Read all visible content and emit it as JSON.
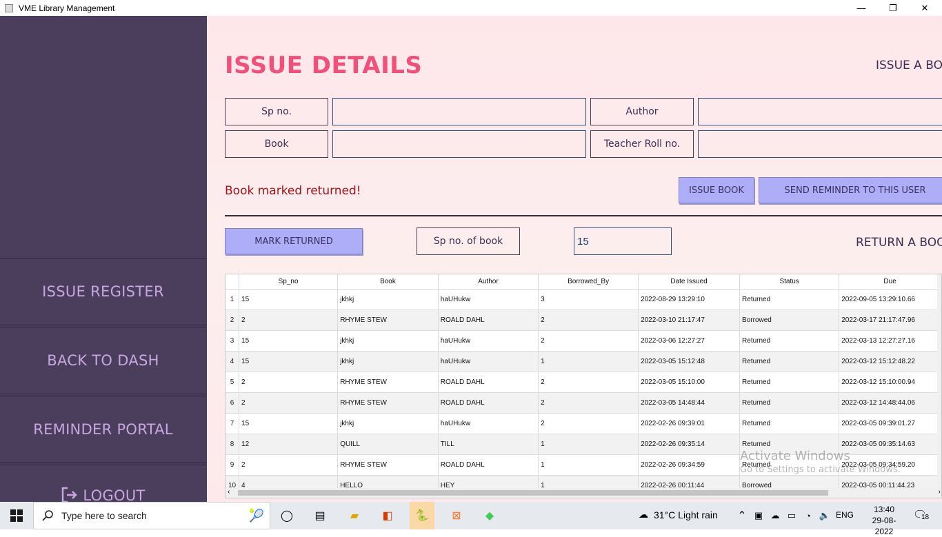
{
  "window": {
    "title": "VME Library Management",
    "minimize": "—",
    "restore": "❐",
    "close": "✕"
  },
  "sidebar": {
    "items": [
      {
        "label": "ISSUE REGISTER"
      },
      {
        "label": "BACK TO DASH"
      },
      {
        "label": "REMINDER PORTAL"
      },
      {
        "label": "LOGOUT"
      }
    ]
  },
  "main": {
    "title": "ISSUE DETAILS",
    "issue_section_label": "ISSUE A BOOK",
    "return_section_label": "RETURN A BOOK",
    "form": {
      "sp_no_label": "Sp no.",
      "sp_no_value": "",
      "author_label": "Author",
      "author_value": "",
      "book_label": "Book",
      "book_value": "",
      "teacher_roll_label": "Teacher Roll no.",
      "teacher_roll_value": ""
    },
    "status_message": "Book marked returned!",
    "issue_book_button": "ISSUE BOOK",
    "send_reminder_button": "SEND REMINDER TO THIS USER",
    "mark_returned_button": "MARK RETURNED",
    "sp_no_of_book_label": "Sp no. of book",
    "sp_no_of_book_value": "15"
  },
  "table": {
    "columns": [
      "Sp_no",
      "Book",
      "Author",
      "Borrowed_By",
      "Date Issued",
      "Status",
      "Due"
    ],
    "rows": [
      [
        "1",
        "15",
        "jkhkj",
        "haUHukw",
        "3",
        "2022-08-29 13:29:10",
        "Returned",
        "2022-09-05 13:29:10.66"
      ],
      [
        "2",
        "2",
        "RHYME STEW",
        "ROALD DAHL",
        "2",
        "2022-03-10 21:17:47",
        "Borrowed",
        "2022-03-17 21:17:47.96"
      ],
      [
        "3",
        "15",
        "jkhkj",
        "haUHukw",
        "2",
        "2022-03-06 12:27:27",
        "Returned",
        "2022-03-13 12:27:27.16"
      ],
      [
        "4",
        "15",
        "jkhkj",
        "haUHukw",
        "1",
        "2022-03-05 15:12:48",
        "Returned",
        "2022-03-12 15:12:48.22"
      ],
      [
        "5",
        "2",
        "RHYME STEW",
        "ROALD DAHL",
        "2",
        "2022-03-05 15:10:00",
        "Returned",
        "2022-03-12 15:10:00.94"
      ],
      [
        "6",
        "2",
        "RHYME STEW",
        "ROALD DAHL",
        "2",
        "2022-03-05 14:48:44",
        "Returned",
        "2022-03-12 14:48:44.06"
      ],
      [
        "7",
        "15",
        "jkhkj",
        "haUHukw",
        "2",
        "2022-02-26 09:39:01",
        "Returned",
        "2022-03-05 09:39:01.27"
      ],
      [
        "8",
        "12",
        "QUILL",
        "TILL",
        "1",
        "2022-02-26 09:35:14",
        "Returned",
        "2022-03-05 09:35:14.63"
      ],
      [
        "9",
        "2",
        "RHYME STEW",
        "ROALD DAHL",
        "1",
        "2022-02-26 09:34:59",
        "Returned",
        "2022-03-05 09:34:59.20"
      ],
      [
        "10",
        "4",
        "HELLO",
        "HEY",
        "1",
        "2022-02-26 00:11:44",
        "Borrowed",
        "2022-03-05 00:11:44.23"
      ]
    ]
  },
  "watermark": {
    "line1": "Activate Windows",
    "line2": "Go to Settings to activate Windows."
  },
  "taskbar": {
    "search_placeholder": "Type here to search",
    "weather": "31°C  Light rain",
    "language": "ENG",
    "time": "13:40",
    "date": "29-08-2022",
    "notification_count": "18"
  }
}
